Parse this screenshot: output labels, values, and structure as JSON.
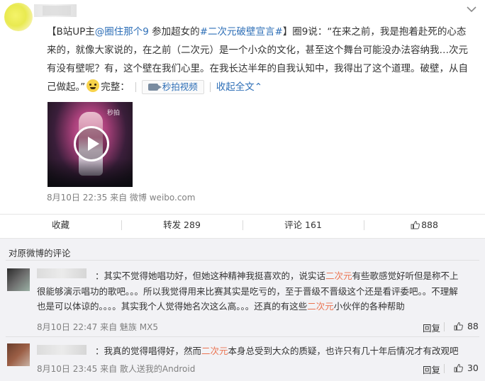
{
  "post": {
    "text_p1": "【B站UP主",
    "mention": "@圈住那个9",
    "text_p2": " 参加超女的",
    "hashtag": "#二次元破壁宣言#",
    "text_p3": "】圈9说：“在来之前，我是抱着赴死的心态来的，就像大家说的，在之前（二次元）是一个小众的文化，甚至这个舞台可能没办法容纳我…次元有没有壁呢？有，这个壁在我们心里。在我长达半年的自我认知中，我得出了这个道理。破壁，从自己做起。”",
    "text_p4": "完整：",
    "video_button": "秒拍视频",
    "collapse_link": "收起全文",
    "collapse_arrow": "⌃",
    "thumb_logo": "秒拍",
    "meta": "8月10日 22:35 来自 微博 weibo.com"
  },
  "actions": {
    "collect": "收藏",
    "repost": "转发 289",
    "comment": "评论 161",
    "like": "888"
  },
  "comments": {
    "header": "对原微博的评论",
    "items": [
      {
        "text_a": "：其实不觉得她唱功好，但她这种精神我挺喜欢的，说实话",
        "hl_a": "二次元",
        "text_b": "有些歌感觉好听但是称不上很能够演示唱功的歌吧。。。所以我觉得用来比赛其实是吃亏的，至于晋级不晋级这个还是看评委吧。。不理解也是可以体谅的。。。。其实我个人觉得她名次这么高。。。还真的有这些",
        "hl_b": "二次元",
        "text_c": "小伙伴的各种帮助",
        "meta": "8月10日 22:47 来自 魅族 MX5",
        "reply": "回复",
        "likes": "88"
      },
      {
        "text_a": "：我真的觉得唱得好，然而",
        "hl_a": "二次元",
        "text_b": "本身总受到大众的质疑，也许只有几十年后情况才有改观吧",
        "meta": "8月10日 23:45 来自 散人送我的Android",
        "reply": "回复",
        "likes": "30"
      }
    ]
  }
}
